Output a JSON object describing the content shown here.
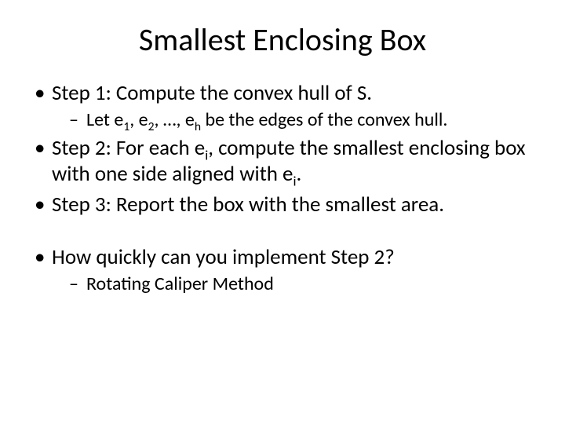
{
  "title": "Smallest Enclosing Box",
  "bullets": {
    "step1": "Step 1: Compute the convex hull of S.",
    "step1_sub_a": "Let e",
    "step1_sub_b": ", e",
    "step1_sub_c": ", …, e",
    "step1_sub_d": " be the edges of the convex hull.",
    "step2_a": "Step 2: For each e",
    "step2_b": ", compute the smallest enclosing box with one side aligned with e",
    "step2_c": ".",
    "step3": "Step 3: Report the box with the smallest area.",
    "q": "How quickly can you implement Step 2?",
    "q_sub": "Rotating Caliper Method"
  },
  "subs": {
    "one": "1",
    "two": "2",
    "h": "h",
    "i": "i"
  }
}
